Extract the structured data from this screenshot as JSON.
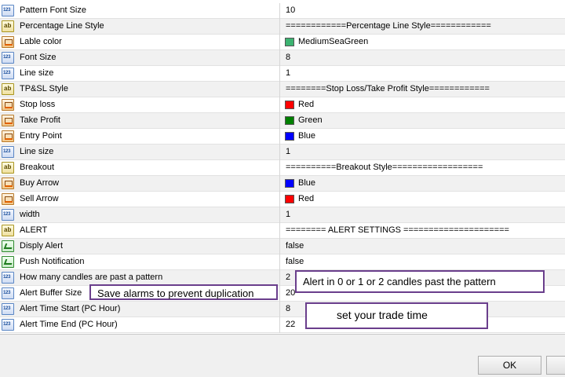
{
  "rows": [
    {
      "icon": "num",
      "icon_name": "number-icon",
      "label": "Pattern Font Size",
      "value": "10"
    },
    {
      "icon": "str",
      "icon_name": "text-icon",
      "label": "Percentage Line Style",
      "value": "============Percentage Line Style============"
    },
    {
      "icon": "color",
      "icon_name": "color-icon",
      "label": "Lable color",
      "value": "MediumSeaGreen",
      "swatch": "#3cb371"
    },
    {
      "icon": "num",
      "icon_name": "number-icon",
      "label": "Font Size",
      "value": "8"
    },
    {
      "icon": "num",
      "icon_name": "number-icon",
      "label": "Line size",
      "value": "1"
    },
    {
      "icon": "str",
      "icon_name": "text-icon",
      "label": "TP&SL Style",
      "value": "========Stop Loss/Take Profit Style============"
    },
    {
      "icon": "color",
      "icon_name": "color-icon",
      "label": "Stop loss",
      "value": "Red",
      "swatch": "#ff0000"
    },
    {
      "icon": "color",
      "icon_name": "color-icon",
      "label": "Take Profit",
      "value": "Green",
      "swatch": "#008000"
    },
    {
      "icon": "color",
      "icon_name": "color-icon",
      "label": "Entry Point",
      "value": "Blue",
      "swatch": "#0000ff"
    },
    {
      "icon": "num",
      "icon_name": "number-icon",
      "label": "Line size",
      "value": "1"
    },
    {
      "icon": "str",
      "icon_name": "text-icon",
      "label": "Breakout",
      "value": "==========Breakout Style=================="
    },
    {
      "icon": "color",
      "icon_name": "color-icon",
      "label": "Buy Arrow",
      "value": "Blue",
      "swatch": "#0000ff"
    },
    {
      "icon": "color",
      "icon_name": "color-icon",
      "label": "Sell Arrow",
      "value": "Red",
      "swatch": "#ff0000"
    },
    {
      "icon": "num",
      "icon_name": "number-icon",
      "label": "width",
      "value": "1"
    },
    {
      "icon": "str",
      "icon_name": "text-icon",
      "label": "ALERT",
      "value": "======== ALERT SETTINGS ====================="
    },
    {
      "icon": "bool",
      "icon_name": "boolean-icon",
      "label": "Disply Alert",
      "value": "false"
    },
    {
      "icon": "bool",
      "icon_name": "boolean-icon",
      "label": "Push Notification",
      "value": "false"
    },
    {
      "icon": "num",
      "icon_name": "number-icon",
      "label": "How many candles are past a pattern",
      "value": "2"
    },
    {
      "icon": "num",
      "icon_name": "number-icon",
      "label": "Alert Buffer Size",
      "value": "20"
    },
    {
      "icon": "num",
      "icon_name": "number-icon",
      "label": "Alert Time Start (PC Hour)",
      "value": "8"
    },
    {
      "icon": "num",
      "icon_name": "number-icon",
      "label": "Alert Time End (PC Hour)",
      "value": "22"
    }
  ],
  "annotations": {
    "candles_note": "Alert in 0 or 1 or 2 candles past the pattern",
    "buffer_note": "Save alarms to prevent duplication",
    "time_note": "set your trade time"
  },
  "buttons": {
    "ok": "OK"
  }
}
